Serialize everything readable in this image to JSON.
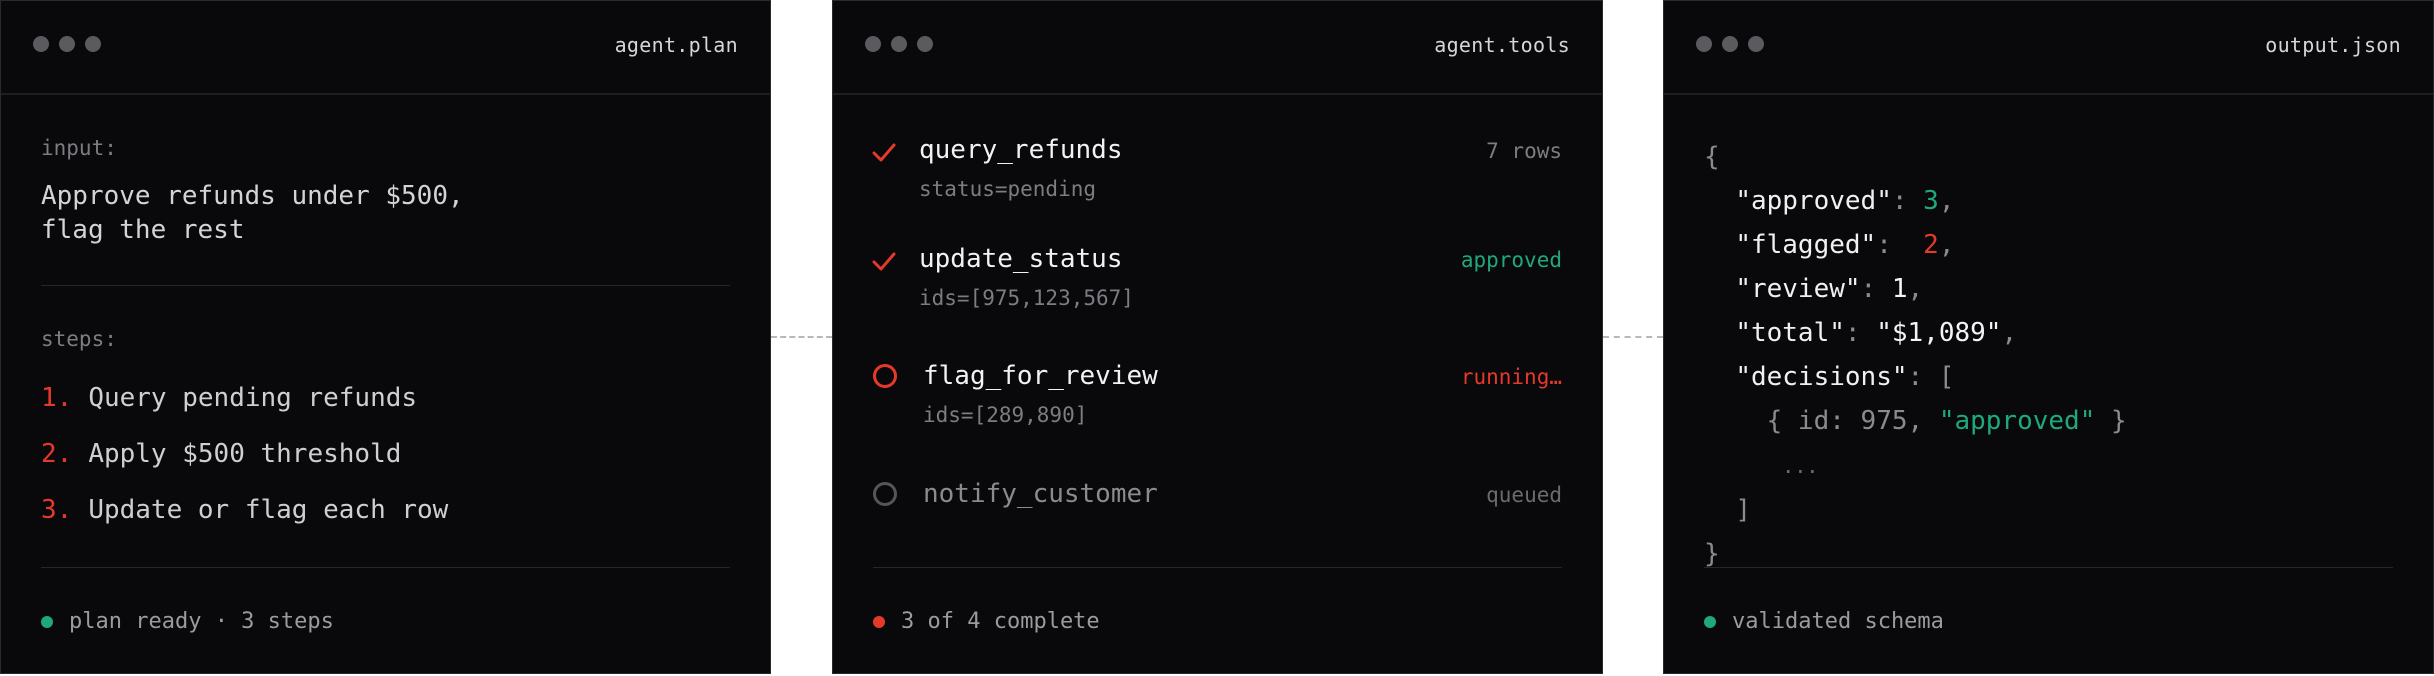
{
  "plan": {
    "window_title": "agent.plan",
    "input_label": "input:",
    "input_text": "Approve refunds under $500,\nflag the rest",
    "steps_label": "steps:",
    "steps": [
      {
        "num": "1.",
        "text": "Query pending refunds"
      },
      {
        "num": "2.",
        "text": "Apply $500 threshold"
      },
      {
        "num": "3.",
        "text": "Update or flag each row"
      }
    ],
    "footer": "plan ready · 3 steps"
  },
  "tools": {
    "window_title": "agent.tools",
    "items": [
      {
        "name": "query_refunds",
        "args": "status=pending",
        "status": "7 rows",
        "state": "done"
      },
      {
        "name": "update_status",
        "args": "ids=[975,123,567]",
        "status": "approved",
        "state": "done"
      },
      {
        "name": "flag_for_review",
        "args": "ids=[289,890]",
        "status": "running…",
        "state": "running"
      },
      {
        "name": "notify_customer",
        "args": "",
        "status": "queued",
        "state": "queued"
      }
    ],
    "footer": "3 of 4 complete"
  },
  "output": {
    "window_title": "output.json",
    "open_brace": "{",
    "approved_key": "\"approved\"",
    "approved_val": "3",
    "flagged_key": "\"flagged\"",
    "flagged_val": "2",
    "review_key": "\"review\"",
    "review_val": "1",
    "total_key": "\"total\"",
    "total_val": "\"$1,089\"",
    "decisions_key": "\"decisions\"",
    "decision_entry_prefix": "{ id: 975, ",
    "decision_entry_value": "\"approved\"",
    "decision_entry_suffix": " }",
    "ellipsis": "...",
    "close_bracket": "]",
    "close_brace": "}",
    "footer": "validated schema"
  },
  "colors": {
    "accent_red": "#e5392a",
    "accent_green": "#1fa97a",
    "panel_bg": "#09090b"
  }
}
